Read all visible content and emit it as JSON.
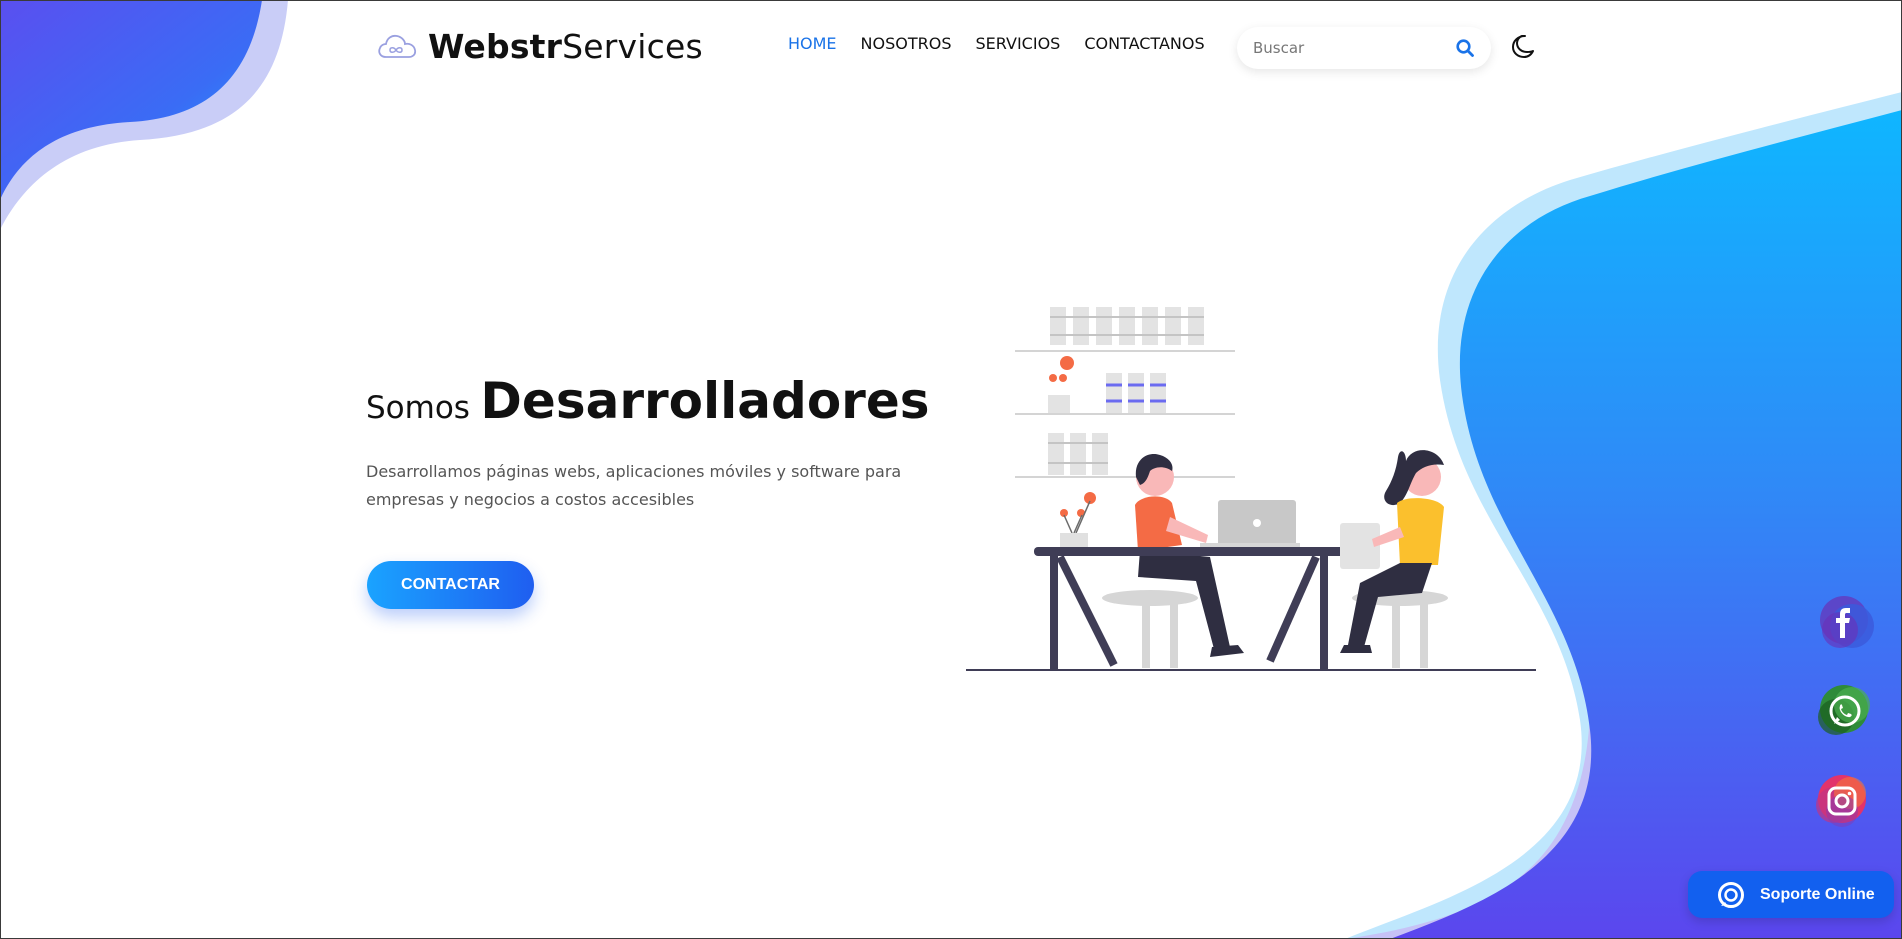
{
  "brand": {
    "name_bold": "Webstr",
    "name_light": "Services"
  },
  "nav": {
    "items": [
      {
        "label": "HOME",
        "active": true
      },
      {
        "label": "NOSOTROS",
        "active": false
      },
      {
        "label": "SERVICIOS",
        "active": false
      },
      {
        "label": "CONTACTANOS",
        "active": false
      }
    ]
  },
  "search": {
    "placeholder": "Buscar",
    "icon": "search-icon"
  },
  "theme_toggle": {
    "icon": "moon-icon"
  },
  "hero": {
    "title_pre": "Somos",
    "title_main": "Desarrolladores",
    "description": "Desarrollamos páginas webs, aplicaciones móviles y software para empresas y negocios a costos accesibles",
    "cta_label": "CONTACTAR"
  },
  "social": [
    {
      "name": "facebook-icon"
    },
    {
      "name": "whatsapp-icon"
    },
    {
      "name": "instagram-icon"
    }
  ],
  "support": {
    "label": "Soporte Online",
    "icon": "support-chat-icon"
  },
  "colors": {
    "accent": "#1a73e8",
    "button_start": "#1aa3ff",
    "button_end": "#1f5ef0",
    "blob_blue": "#1aa3ff",
    "blob_purple": "#5b4df0",
    "support_bg": "#1260ef"
  }
}
